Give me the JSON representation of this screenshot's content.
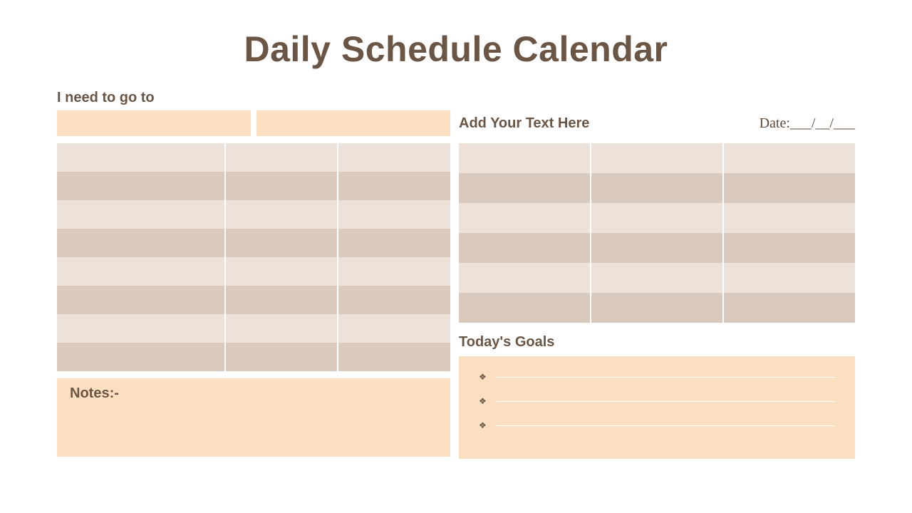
{
  "title": "Daily Schedule Calendar",
  "need_to_go_label": "I need to go to",
  "add_text_label": "Add Your Text Here",
  "date_label": "Date:___/__/___",
  "notes_label": "Notes:-",
  "goals_label": "Today's Goals",
  "colors": {
    "accent_peach": "#fcdfc0",
    "row_light": "#ece2d9",
    "row_dark": "#dac9bd",
    "text": "#6b5544"
  },
  "left_table": {
    "rows": 8,
    "cols": 3
  },
  "right_table": {
    "rows": 6,
    "cols": 3
  },
  "goals_count": 3
}
